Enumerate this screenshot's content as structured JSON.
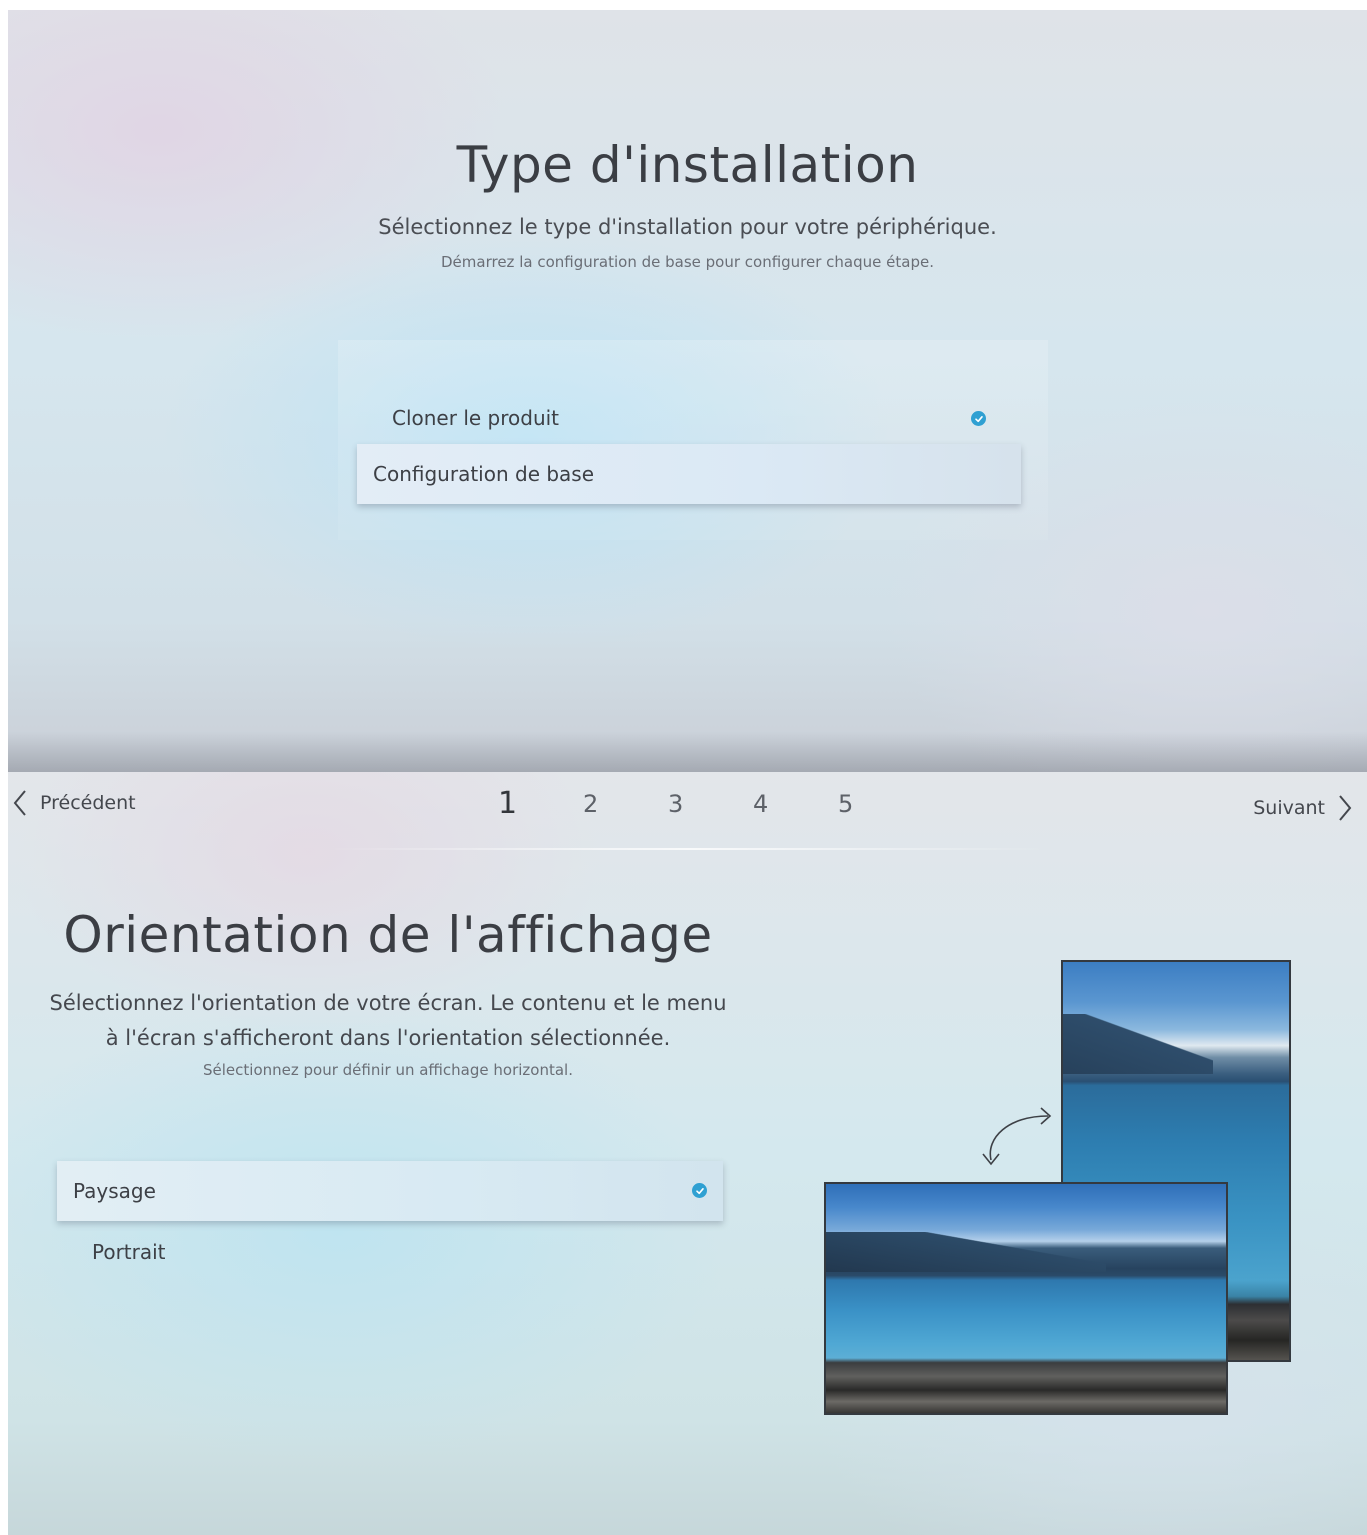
{
  "screen_installation": {
    "title": "Type d'installation",
    "subtitle": "Sélectionnez le type d'installation pour votre périphérique.",
    "hint": "Démarrez la configuration de base pour configurer chaque étape.",
    "options": [
      {
        "label": "Cloner le produit",
        "checked": true,
        "focused": false
      },
      {
        "label": "Configuration de base",
        "checked": false,
        "focused": true
      }
    ]
  },
  "screen_orientation": {
    "nav": {
      "back_label": "Précédent",
      "next_label": "Suivant",
      "steps": [
        "1",
        "2",
        "3",
        "4",
        "5"
      ],
      "current_step": "1"
    },
    "title": "Orientation de l'affichage",
    "subtitle": "Sélectionnez l'orientation de votre écran. Le contenu et le menu à l'écran s'afficheront dans l'orientation sélectionnée.",
    "hint": "Sélectionnez pour définir un affichage horizontal.",
    "options": [
      {
        "label": "Paysage",
        "checked": true,
        "focused": true
      },
      {
        "label": "Portrait",
        "checked": false,
        "focused": false
      }
    ],
    "illustration": {
      "icons": [
        "portrait-screen-image",
        "rotate-arrows-icon",
        "landscape-screen-image"
      ]
    }
  },
  "colors": {
    "check_accent": "#2fa0d2",
    "text_primary": "#3b3e44",
    "focus_bg": "#dbe9f5"
  }
}
